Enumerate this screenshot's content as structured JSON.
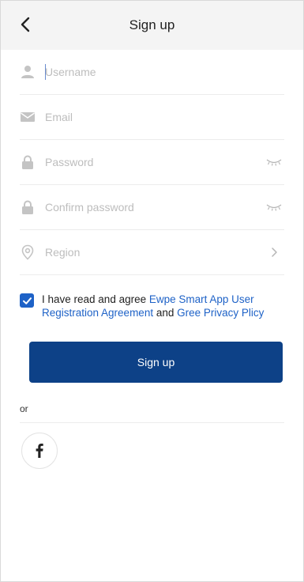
{
  "header": {
    "title": "Sign up"
  },
  "form": {
    "username": {
      "placeholder": "Username",
      "value": ""
    },
    "email": {
      "placeholder": "Email",
      "value": ""
    },
    "password": {
      "placeholder": "Password",
      "value": ""
    },
    "confirm_password": {
      "placeholder": "Confirm password",
      "value": ""
    },
    "region": {
      "label": "Region"
    }
  },
  "agreement": {
    "checked": true,
    "prefix": "I have read and agree ",
    "link1": "Ewpe Smart App User Registration Agreement",
    "middle": " and ",
    "link2": "Gree Privacy Plicy"
  },
  "signup_button": {
    "label": "Sign up"
  },
  "alt_login": {
    "or_label": "or",
    "providers": [
      "facebook"
    ]
  },
  "colors": {
    "accent": "#1e62c7",
    "button": "#0d4187",
    "header_bg": "#f4f4f4",
    "placeholder": "#bdbdbd"
  }
}
